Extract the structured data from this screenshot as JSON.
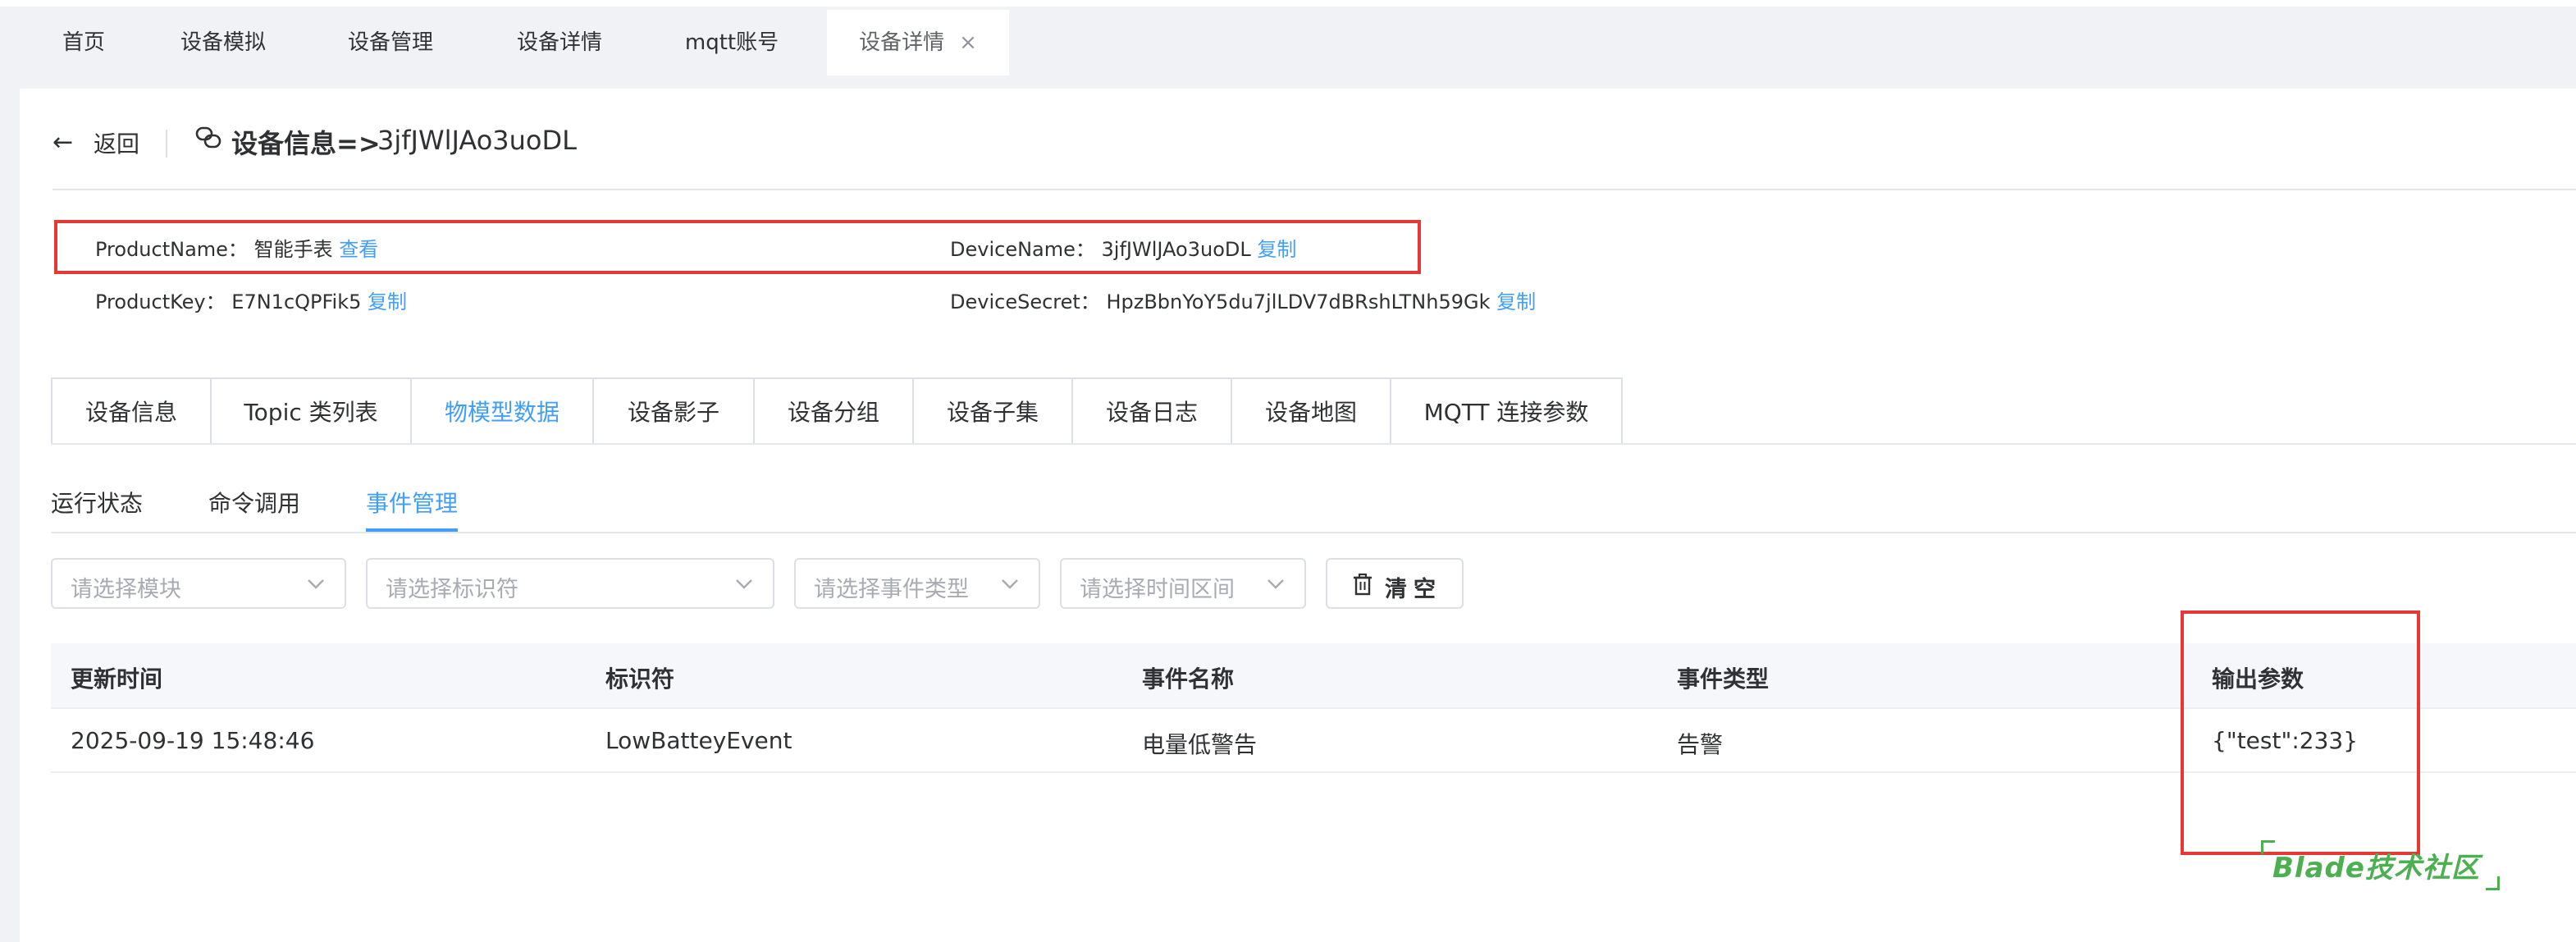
{
  "tabs": [
    {
      "label": "首页"
    },
    {
      "label": "设备模拟"
    },
    {
      "label": "设备管理"
    },
    {
      "label": "设备详情"
    },
    {
      "label": "mqtt账号"
    },
    {
      "label": "设备详情",
      "close": "×"
    }
  ],
  "header": {
    "back_label": "返回",
    "back_icon": "←",
    "title": "设备信息=>",
    "device": "3jfJWlJAo3uoDL"
  },
  "info": {
    "product_name_label": "ProductName：",
    "product_name": "智能手表",
    "product_name_link": "查看",
    "device_name_label": "DeviceName：",
    "device_name": "3jfJWlJAo3uoDL",
    "device_name_link": "复制",
    "product_key_label": "ProductKey：",
    "product_key": "E7N1cQPFik5",
    "product_key_link": "复制",
    "device_secret_label": "DeviceSecret：",
    "device_secret": "HpzBbnYoY5du7jlLDV7dBRshLTNh59Gk",
    "device_secret_link": "复制"
  },
  "card_tabs": [
    "设备信息",
    "Topic 类列表",
    "物模型数据",
    "设备影子",
    "设备分组",
    "设备子集",
    "设备日志",
    "设备地图",
    "MQTT 连接参数"
  ],
  "card_tab_active": "物模型数据",
  "sub_tabs": [
    "运行状态",
    "命令调用",
    "事件管理"
  ],
  "sub_tab_active": "事件管理",
  "filters": {
    "module_placeholder": "请选择模块",
    "identifier_placeholder": "请选择标识符",
    "event_type_placeholder": "请选择事件类型",
    "time_range_placeholder": "请选择时间区间",
    "clear_label": "清空"
  },
  "table": {
    "headers": [
      "更新时间",
      "标识符",
      "事件名称",
      "事件类型",
      "输出参数"
    ],
    "rows": [
      [
        "2025-09-19 15:48:46",
        "LowBatteyEvent",
        "电量低警告",
        "告警",
        "{\"test\":233}"
      ]
    ]
  },
  "watermark": "Blade技术社区",
  "colors": {
    "accent": "#409eff",
    "highlight_box": "#e53935",
    "watermark": "#4caf50"
  }
}
